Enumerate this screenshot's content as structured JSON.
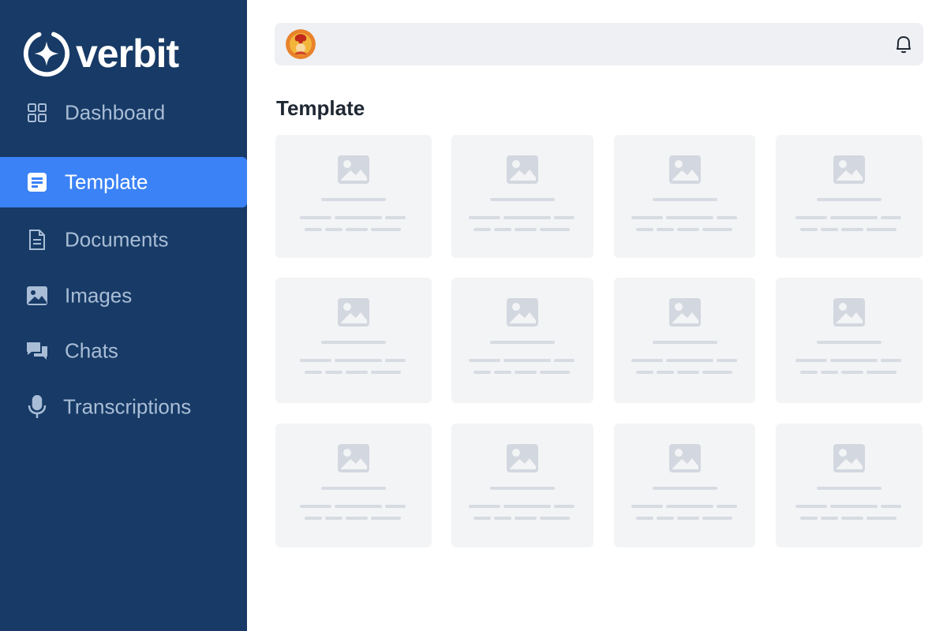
{
  "brand": {
    "name": "verbit"
  },
  "sidebar": {
    "items": [
      {
        "label": "Dashboard",
        "icon": "dashboard-icon",
        "active": false
      },
      {
        "label": "Template",
        "icon": "template-icon",
        "active": true
      },
      {
        "label": "Documents",
        "icon": "document-icon",
        "active": false
      },
      {
        "label": "Images",
        "icon": "image-icon",
        "active": false
      },
      {
        "label": "Chats",
        "icon": "chat-icon",
        "active": false
      },
      {
        "label": "Transcriptions",
        "icon": "microphone-icon",
        "active": false
      }
    ]
  },
  "topbar": {
    "avatar": "user-avatar",
    "notification_icon": "bell-icon"
  },
  "main": {
    "title": "Template",
    "cards": [
      {
        "placeholder": "image-placeholder-icon"
      },
      {
        "placeholder": "image-placeholder-icon"
      },
      {
        "placeholder": "image-placeholder-icon"
      },
      {
        "placeholder": "image-placeholder-icon"
      },
      {
        "placeholder": "image-placeholder-icon"
      },
      {
        "placeholder": "image-placeholder-icon"
      },
      {
        "placeholder": "image-placeholder-icon"
      },
      {
        "placeholder": "image-placeholder-icon"
      },
      {
        "placeholder": "image-placeholder-icon"
      },
      {
        "placeholder": "image-placeholder-icon"
      },
      {
        "placeholder": "image-placeholder-icon"
      },
      {
        "placeholder": "image-placeholder-icon"
      }
    ]
  },
  "colors": {
    "sidebar_bg": "#173a66",
    "active_bg": "#3b82f6",
    "nav_text": "#a9bdd6",
    "card_bg": "#f3f4f6",
    "skeleton": "#d7dbe2"
  }
}
